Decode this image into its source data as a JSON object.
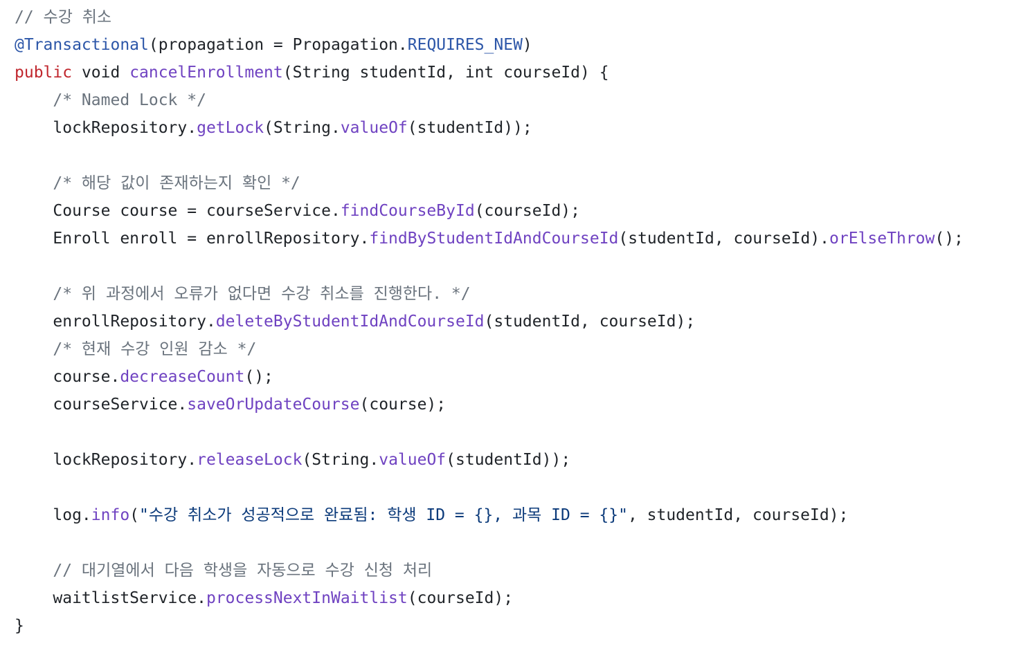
{
  "colors": {
    "comment": "#6a737d",
    "annotation": "#2c56a8",
    "keyword": "#c0262d",
    "method": "#6f42c1",
    "constant": "#2c56a8",
    "string": "#0b3a7a",
    "plain": "#1f2328",
    "background": "#ffffff"
  },
  "lines": [
    [
      {
        "t": "// 수강 취소",
        "k": "comment"
      }
    ],
    [
      {
        "t": "@Transactional",
        "k": "annotation"
      },
      {
        "t": "(propagation = Propagation.",
        "k": "plain"
      },
      {
        "t": "REQUIRES_NEW",
        "k": "const"
      },
      {
        "t": ")",
        "k": "plain"
      }
    ],
    [
      {
        "t": "public",
        "k": "keyword"
      },
      {
        "t": " void ",
        "k": "plain"
      },
      {
        "t": "cancelEnrollment",
        "k": "method"
      },
      {
        "t": "(String studentId, int courseId) {",
        "k": "plain"
      }
    ],
    [
      {
        "t": "    ",
        "k": "plain"
      },
      {
        "t": "/* Named Lock */",
        "k": "comment"
      }
    ],
    [
      {
        "t": "    lockRepository.",
        "k": "plain"
      },
      {
        "t": "getLock",
        "k": "method"
      },
      {
        "t": "(String.",
        "k": "plain"
      },
      {
        "t": "valueOf",
        "k": "method"
      },
      {
        "t": "(studentId));",
        "k": "plain"
      }
    ],
    [],
    [
      {
        "t": "    ",
        "k": "plain"
      },
      {
        "t": "/* 해당 값이 존재하는지 확인 */",
        "k": "comment"
      }
    ],
    [
      {
        "t": "    Course course = courseService.",
        "k": "plain"
      },
      {
        "t": "findCourseById",
        "k": "method"
      },
      {
        "t": "(courseId);",
        "k": "plain"
      }
    ],
    [
      {
        "t": "    Enroll enroll = enrollRepository.",
        "k": "plain"
      },
      {
        "t": "findByStudentIdAndCourseId",
        "k": "method"
      },
      {
        "t": "(studentId, courseId).",
        "k": "plain"
      },
      {
        "t": "orElseThrow",
        "k": "method"
      },
      {
        "t": "();",
        "k": "plain"
      }
    ],
    [],
    [
      {
        "t": "    ",
        "k": "plain"
      },
      {
        "t": "/* 위 과정에서 오류가 없다면 수강 취소를 진행한다. */",
        "k": "comment"
      }
    ],
    [
      {
        "t": "    enrollRepository.",
        "k": "plain"
      },
      {
        "t": "deleteByStudentIdAndCourseId",
        "k": "method"
      },
      {
        "t": "(studentId, courseId);",
        "k": "plain"
      }
    ],
    [
      {
        "t": "    ",
        "k": "plain"
      },
      {
        "t": "/* 현재 수강 인원 감소 */",
        "k": "comment"
      }
    ],
    [
      {
        "t": "    course.",
        "k": "plain"
      },
      {
        "t": "decreaseCount",
        "k": "method"
      },
      {
        "t": "();",
        "k": "plain"
      }
    ],
    [
      {
        "t": "    courseService.",
        "k": "plain"
      },
      {
        "t": "saveOrUpdateCourse",
        "k": "method"
      },
      {
        "t": "(course);",
        "k": "plain"
      }
    ],
    [],
    [
      {
        "t": "    lockRepository.",
        "k": "plain"
      },
      {
        "t": "releaseLock",
        "k": "method"
      },
      {
        "t": "(String.",
        "k": "plain"
      },
      {
        "t": "valueOf",
        "k": "method"
      },
      {
        "t": "(studentId));",
        "k": "plain"
      }
    ],
    [],
    [
      {
        "t": "    log.",
        "k": "plain"
      },
      {
        "t": "info",
        "k": "method"
      },
      {
        "t": "(",
        "k": "plain"
      },
      {
        "t": "\"수강 취소가 성공적으로 완료됨: 학생 ID = {}, 과목 ID = {}\"",
        "k": "string"
      },
      {
        "t": ", studentId, courseId);",
        "k": "plain"
      }
    ],
    [],
    [
      {
        "t": "    ",
        "k": "plain"
      },
      {
        "t": "// 대기열에서 다음 학생을 자동으로 수강 신청 처리",
        "k": "comment"
      }
    ],
    [
      {
        "t": "    waitlistService.",
        "k": "plain"
      },
      {
        "t": "processNextInWaitlist",
        "k": "method"
      },
      {
        "t": "(courseId);",
        "k": "plain"
      }
    ],
    [
      {
        "t": "}",
        "k": "plain"
      }
    ]
  ]
}
